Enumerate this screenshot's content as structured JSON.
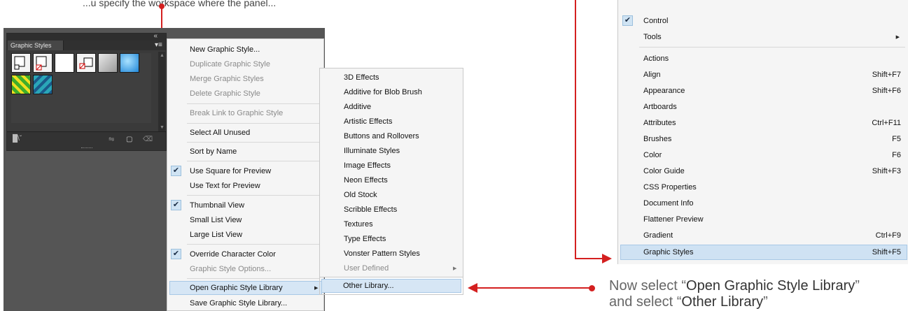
{
  "caption_top": "...u specify the workspace where the panel...",
  "panel": {
    "tab_label": "Graphic Styles",
    "collapse_icon": "double-chevron-left",
    "menu_icon": "flyout-menu-icon",
    "thumbnails_row1": [
      "#f4f4f4",
      "#f4f4f4",
      "#ffffff",
      "#f4f4f4",
      "#cccccc",
      "#3a9ee0"
    ],
    "thumbnails_row2": [
      "#5fbf30",
      "#2a8ab0"
    ]
  },
  "flyout_menu": {
    "items": [
      {
        "label": "New Graphic Style...",
        "disabled": false
      },
      {
        "label": "Duplicate Graphic Style",
        "disabled": true
      },
      {
        "label": "Merge Graphic Styles",
        "disabled": true
      },
      {
        "label": "Delete Graphic Style",
        "disabled": true
      },
      {
        "label": "Break Link to Graphic Style",
        "disabled": true
      },
      {
        "label": "Select All Unused",
        "disabled": false
      },
      {
        "label": "Sort by Name",
        "disabled": false
      },
      {
        "label": "Use Square for Preview",
        "disabled": false,
        "checked": true
      },
      {
        "label": "Use Text for Preview",
        "disabled": false
      },
      {
        "label": "Thumbnail View",
        "disabled": false,
        "checked": true
      },
      {
        "label": "Small List View",
        "disabled": false
      },
      {
        "label": "Large List View",
        "disabled": false
      },
      {
        "label": "Override Character Color",
        "disabled": false,
        "checked": true
      },
      {
        "label": "Graphic Style Options...",
        "disabled": true
      },
      {
        "label": "Open Graphic Style Library",
        "disabled": false,
        "highlighted": true
      },
      {
        "label": "Save Graphic Style Library...",
        "disabled": false
      }
    ]
  },
  "library_submenu": {
    "items": [
      {
        "label": "3D Effects"
      },
      {
        "label": "Additive for Blob Brush"
      },
      {
        "label": "Additive"
      },
      {
        "label": "Artistic Effects"
      },
      {
        "label": "Buttons and Rollovers"
      },
      {
        "label": "Illuminate Styles"
      },
      {
        "label": "Image Effects"
      },
      {
        "label": "Neon Effects"
      },
      {
        "label": "Old Stock"
      },
      {
        "label": "Scribble Effects"
      },
      {
        "label": "Textures"
      },
      {
        "label": "Type Effects"
      },
      {
        "label": "Vonster Pattern Styles"
      },
      {
        "label": "User Defined",
        "disabled": true
      },
      {
        "label": "Other Library...",
        "highlighted": true
      }
    ]
  },
  "window_menu": {
    "items": [
      {
        "label": "Control",
        "checked": true,
        "shortcut": ""
      },
      {
        "label": "Tools",
        "shortcut": ""
      },
      {
        "label": "Actions",
        "shortcut": ""
      },
      {
        "label": "Align",
        "shortcut": "Shift+F7"
      },
      {
        "label": "Appearance",
        "shortcut": "Shift+F6"
      },
      {
        "label": "Artboards",
        "shortcut": ""
      },
      {
        "label": "Attributes",
        "shortcut": "Ctrl+F11"
      },
      {
        "label": "Brushes",
        "shortcut": "F5"
      },
      {
        "label": "Color",
        "shortcut": "F6"
      },
      {
        "label": "Color Guide",
        "shortcut": "Shift+F3"
      },
      {
        "label": "CSS Properties",
        "shortcut": ""
      },
      {
        "label": "Document Info",
        "shortcut": ""
      },
      {
        "label": "Flattener Preview",
        "shortcut": ""
      },
      {
        "label": "Gradient",
        "shortcut": "Ctrl+F9"
      },
      {
        "label": "Graphic Styles",
        "shortcut": "Shift+F5",
        "highlighted": true
      }
    ]
  },
  "caption": {
    "prefix": "Now select “",
    "strong1": "Open Graphic Style Library",
    "middle": "”",
    "line2_prefix": "and select “",
    "strong2": "Other Library",
    "line2_suffix": "”"
  },
  "colors": {
    "annotation_red": "#d42020",
    "highlight_blue": "#d6e6f5"
  }
}
